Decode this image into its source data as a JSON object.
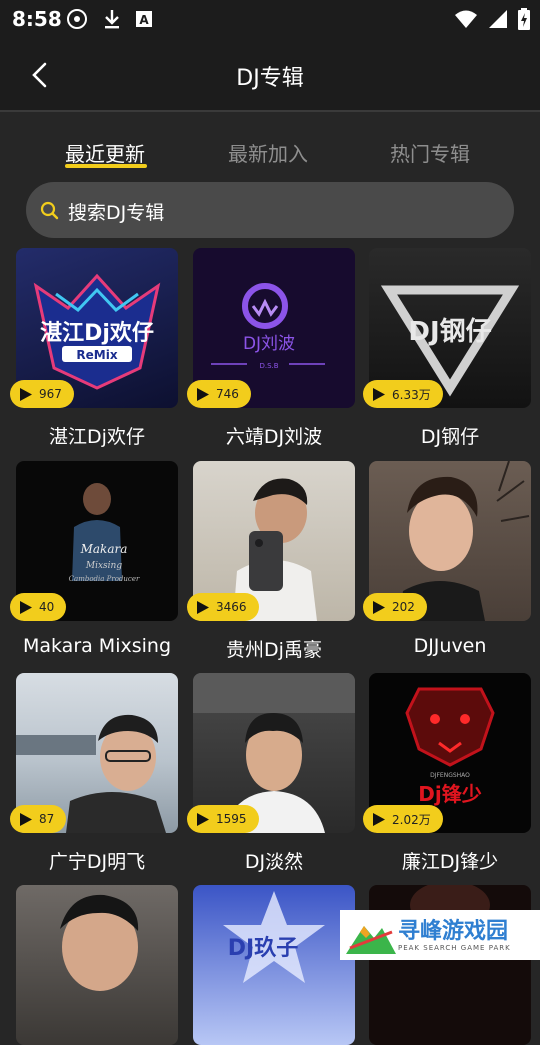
{
  "status": {
    "time": "8:58"
  },
  "header": {
    "title": "DJ专辑"
  },
  "tabs": [
    {
      "label": "最近更新"
    },
    {
      "label": "最新加入"
    },
    {
      "label": "热门专辑"
    }
  ],
  "search": {
    "placeholder": "搜索DJ专辑"
  },
  "albums": [
    {
      "name": "湛江Dj欢仔",
      "plays": "967",
      "cover_text": "湛江Dj欢仔",
      "cover_sub": "ReMix"
    },
    {
      "name": "六靖DJ刘波",
      "plays": "746",
      "cover_text": "DJ刘波",
      "cover_sub": "D.S.B"
    },
    {
      "name": "DJ钢仔",
      "plays": "6.33万",
      "cover_text": "DJ钢仔"
    },
    {
      "name": "Makara Mixsing",
      "plays": "40",
      "cover_text": "Makara",
      "cover_sub": "Mixsing",
      "cover_sub2": "Cambodia Producer"
    },
    {
      "name": "贵州Dj禹豪",
      "plays": "3466"
    },
    {
      "name": "DJJuven",
      "plays": "202"
    },
    {
      "name": "广宁DJ明飞",
      "plays": "87"
    },
    {
      "name": "DJ淡然",
      "plays": "1595"
    },
    {
      "name": "廉江DJ锋少",
      "plays": "2.02万",
      "cover_text": "Dj锋少",
      "cover_sub": "DJFENGSHAO"
    },
    {
      "name": "",
      "plays": ""
    },
    {
      "name": "",
      "plays": "",
      "cover_text": "DJ玖子"
    },
    {
      "name": "",
      "plays": ""
    }
  ],
  "watermark": {
    "title": "寻峰游戏园",
    "subtitle": "PEAK SEARCH GAME PARK"
  },
  "colors": {
    "accent": "#f2cd1c",
    "background": "#262626",
    "bar": "#1c1c1c",
    "search": "#4a4a4a"
  }
}
